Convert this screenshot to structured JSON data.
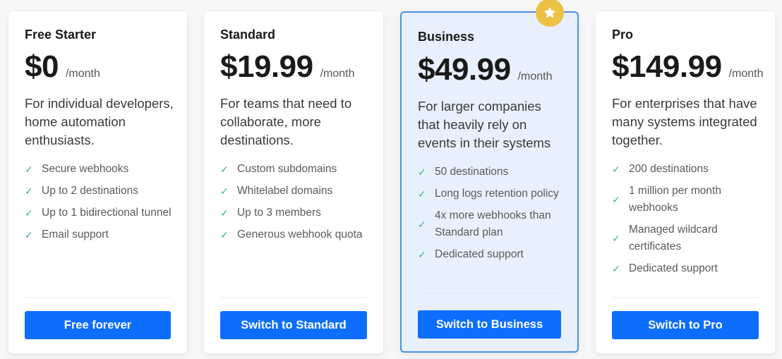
{
  "colors": {
    "accent": "#0d6efd",
    "check": "#3cb46e",
    "highlight_bg": "#e7f0fc",
    "highlight_border": "#4a90e8",
    "badge": "#ecc244"
  },
  "plans": [
    {
      "name": "Free Starter",
      "price": "$0",
      "period": "/month",
      "description": "For individual developers, home automation enthusiasts.",
      "features": [
        "Secure webhooks",
        "Up to 2 destinations",
        "Up to 1 bidirectional tunnel",
        "Email support"
      ],
      "cta": "Free forever"
    },
    {
      "name": "Standard",
      "price": "$19.99",
      "period": "/month",
      "description": "For teams that need to collaborate, more destinations.",
      "features": [
        "Custom subdomains",
        "Whitelabel domains",
        "Up to 3 members",
        "Generous webhook quota"
      ],
      "cta": "Switch to Standard"
    },
    {
      "name": "Business",
      "price": "$49.99",
      "period": "/month",
      "description": "For larger companies that heavily rely on events in their systems",
      "features": [
        "50 destinations",
        "Long logs retention policy",
        "4x more webhooks than Standard plan",
        "Dedicated support"
      ],
      "cta": "Switch to Business",
      "highlighted": true,
      "badge_icon": "star-icon"
    },
    {
      "name": "Pro",
      "price": "$149.99",
      "period": "/month",
      "description": "For enterprises that have many systems integrated together.",
      "features": [
        "200 destinations",
        "1 million per month webhooks",
        "Managed wildcard certificates",
        "Dedicated support"
      ],
      "cta": "Switch to Pro"
    }
  ]
}
